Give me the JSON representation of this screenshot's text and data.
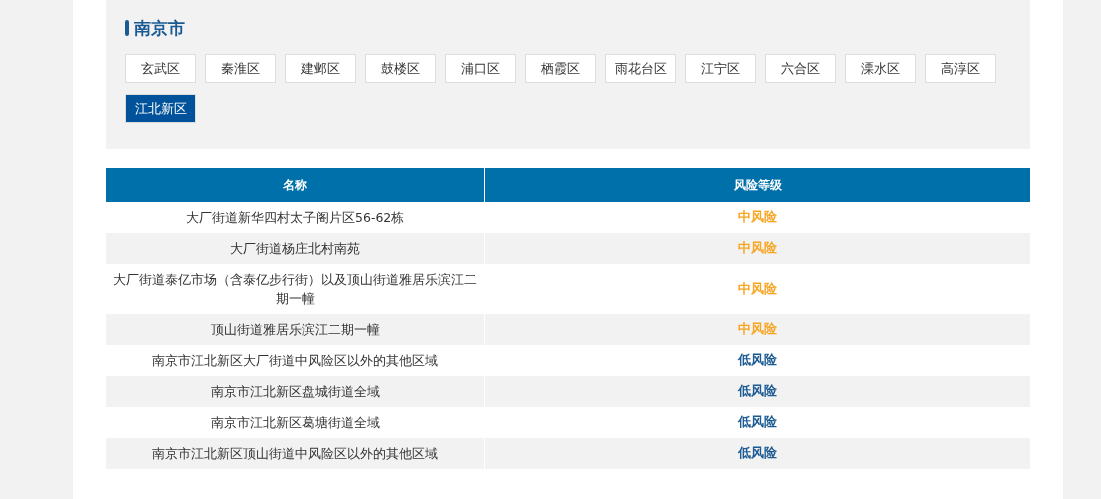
{
  "city": {
    "title": "南京市"
  },
  "districts": [
    {
      "label": "玄武区",
      "selected": false
    },
    {
      "label": "秦淮区",
      "selected": false
    },
    {
      "label": "建邺区",
      "selected": false
    },
    {
      "label": "鼓楼区",
      "selected": false
    },
    {
      "label": "浦口区",
      "selected": false
    },
    {
      "label": "栖霞区",
      "selected": false
    },
    {
      "label": "雨花台区",
      "selected": false
    },
    {
      "label": "江宁区",
      "selected": false
    },
    {
      "label": "六合区",
      "selected": false
    },
    {
      "label": "溧水区",
      "selected": false
    },
    {
      "label": "高淳区",
      "selected": false
    },
    {
      "label": "江北新区",
      "selected": true
    }
  ],
  "table": {
    "columns": [
      "名称",
      "风险等级"
    ],
    "rows": [
      {
        "name": "大厂街道新华四村太子阁片区56-62栋",
        "risk": "中风险",
        "kind": "medium"
      },
      {
        "name": "大厂街道杨庄北村南苑",
        "risk": "中风险",
        "kind": "medium"
      },
      {
        "name": "大厂街道泰亿市场（含泰亿步行街）以及顶山街道雅居乐滨江二期一幢",
        "risk": "中风险",
        "kind": "medium"
      },
      {
        "name": "顶山街道雅居乐滨江二期一幢",
        "risk": "中风险",
        "kind": "medium"
      },
      {
        "name": "南京市江北新区大厂街道中风险区以外的其他区域",
        "risk": "低风险",
        "kind": "low"
      },
      {
        "name": "南京市江北新区盘城街道全域",
        "risk": "低风险",
        "kind": "low"
      },
      {
        "name": "南京市江北新区葛塘街道全域",
        "risk": "低风险",
        "kind": "low"
      },
      {
        "name": "南京市江北新区顶山街道中风险区以外的其他区域",
        "risk": "低风险",
        "kind": "low"
      }
    ]
  }
}
